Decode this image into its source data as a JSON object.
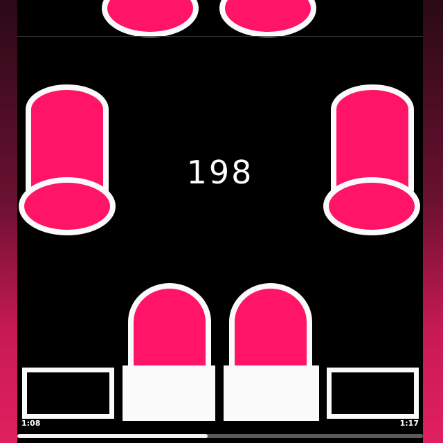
{
  "game": {
    "score": "198",
    "colors": {
      "accent": "#ff1467",
      "outline": "#fafafa",
      "background": "#000000"
    },
    "pads": [
      {
        "name": "pad-1",
        "state": "empty"
      },
      {
        "name": "pad-2",
        "state": "filled"
      },
      {
        "name": "pad-3",
        "state": "filled"
      },
      {
        "name": "pad-4",
        "state": "empty"
      }
    ]
  },
  "player": {
    "elapsed": "1:08",
    "total": "1:17",
    "progress": 0.47
  }
}
